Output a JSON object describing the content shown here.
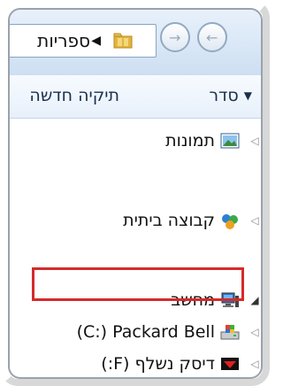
{
  "address_bar": {
    "path_label": "ספריות",
    "breadcrumb_chevron": "◀",
    "folder_icon": "library-folder-icon",
    "back_icon": "back-arrow-icon",
    "forward_icon": "forward-arrow-icon",
    "history_dropdown_icon": "dropdown-chevron-icon"
  },
  "toolbar": {
    "organize_label": "סדר",
    "organize_arrow": "▼",
    "new_folder_label": "תיקיה חדשה"
  },
  "tree": {
    "items": [
      {
        "label": "תמונות",
        "icon": "pictures-icon",
        "expanded": false
      },
      {
        "label": "קבוצה ביתית",
        "icon": "homegroup-icon",
        "expanded": false
      },
      {
        "label": "מחשב",
        "icon": "computer-icon",
        "expanded": true
      },
      {
        "label": "(C:) Packard Bell",
        "icon": "drive-c-icon",
        "expanded": false
      },
      {
        "label": "דיסק נשלף (F:)",
        "icon": "usb-drive-icon",
        "expanded": false
      }
    ],
    "collapsed_arrow": "◁",
    "expanded_arrow": "◢"
  },
  "colors": {
    "highlight_border": "#d62a2a",
    "toolbar_text": "#1b2f4a"
  }
}
